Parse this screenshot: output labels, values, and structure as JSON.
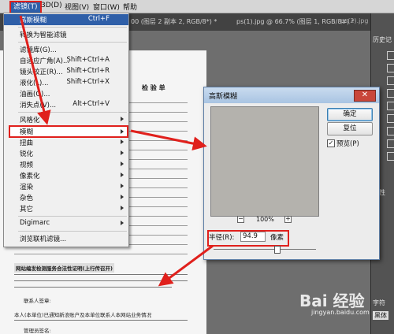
{
  "menubar": {
    "filter": "滤镜(T)",
    "v3d": "3D(D)",
    "view": "视图(V)",
    "window": "窗口(W)",
    "help": "帮助"
  },
  "tabs": {
    "t1": "00 (图层 2 副本 2, RGB/8*) *",
    "t2": "ps(1).jpg @ 66.7% (图层 1, RGB/8#) *",
    "t3": "ps(2).jpg"
  },
  "right_panel": {
    "history": "历史记",
    "props": "属性",
    "char": "字符",
    "font": "黑体",
    "char_label": "字符"
  },
  "menu": {
    "items": [
      {
        "label": "高斯模糊",
        "shortcut": "Ctrl+F"
      },
      {
        "label": "转换为智能滤镜",
        "shortcut": ""
      },
      {
        "label": "滤镜库(G)...",
        "shortcut": ""
      },
      {
        "label": "自适应广角(A)...",
        "shortcut": "Shift+Ctrl+A"
      },
      {
        "label": "镜头校正(R)...",
        "shortcut": "Shift+Ctrl+R"
      },
      {
        "label": "液化(L)...",
        "shortcut": "Shift+Ctrl+X"
      },
      {
        "label": "油画(O)...",
        "shortcut": ""
      },
      {
        "label": "消失点(V)...",
        "shortcut": "Alt+Ctrl+V"
      },
      {
        "label": "风格化",
        "shortcut": ""
      },
      {
        "label": "模糊",
        "shortcut": ""
      },
      {
        "label": "扭曲",
        "shortcut": ""
      },
      {
        "label": "锐化",
        "shortcut": ""
      },
      {
        "label": "视频",
        "shortcut": ""
      },
      {
        "label": "像素化",
        "shortcut": ""
      },
      {
        "label": "渲染",
        "shortcut": ""
      },
      {
        "label": "杂色",
        "shortcut": ""
      },
      {
        "label": "其它",
        "shortcut": ""
      },
      {
        "label": "Digimarc",
        "shortcut": ""
      },
      {
        "label": "浏览联机滤镜...",
        "shortcut": ""
      }
    ]
  },
  "dialog": {
    "title": "高斯模糊",
    "ok": "确定",
    "reset": "复位",
    "preview": "预览(P)",
    "zoom": "100%",
    "radius_label": "半径(R):",
    "radius_value": "94.9",
    "unit": "像素",
    "close": "✕"
  },
  "document": {
    "title": "检 验 单",
    "notice": "网站编发检测服务合法性证明(上行传召开)",
    "contact": "联系人签章:",
    "bottom": "本人(本单位)已通知新浪账户及本单位联系人本网站业务情况",
    "verify": "管理员签名:"
  },
  "watermark": {
    "brand": "Bai 经验",
    "url": "jingyan.baidu.com"
  }
}
